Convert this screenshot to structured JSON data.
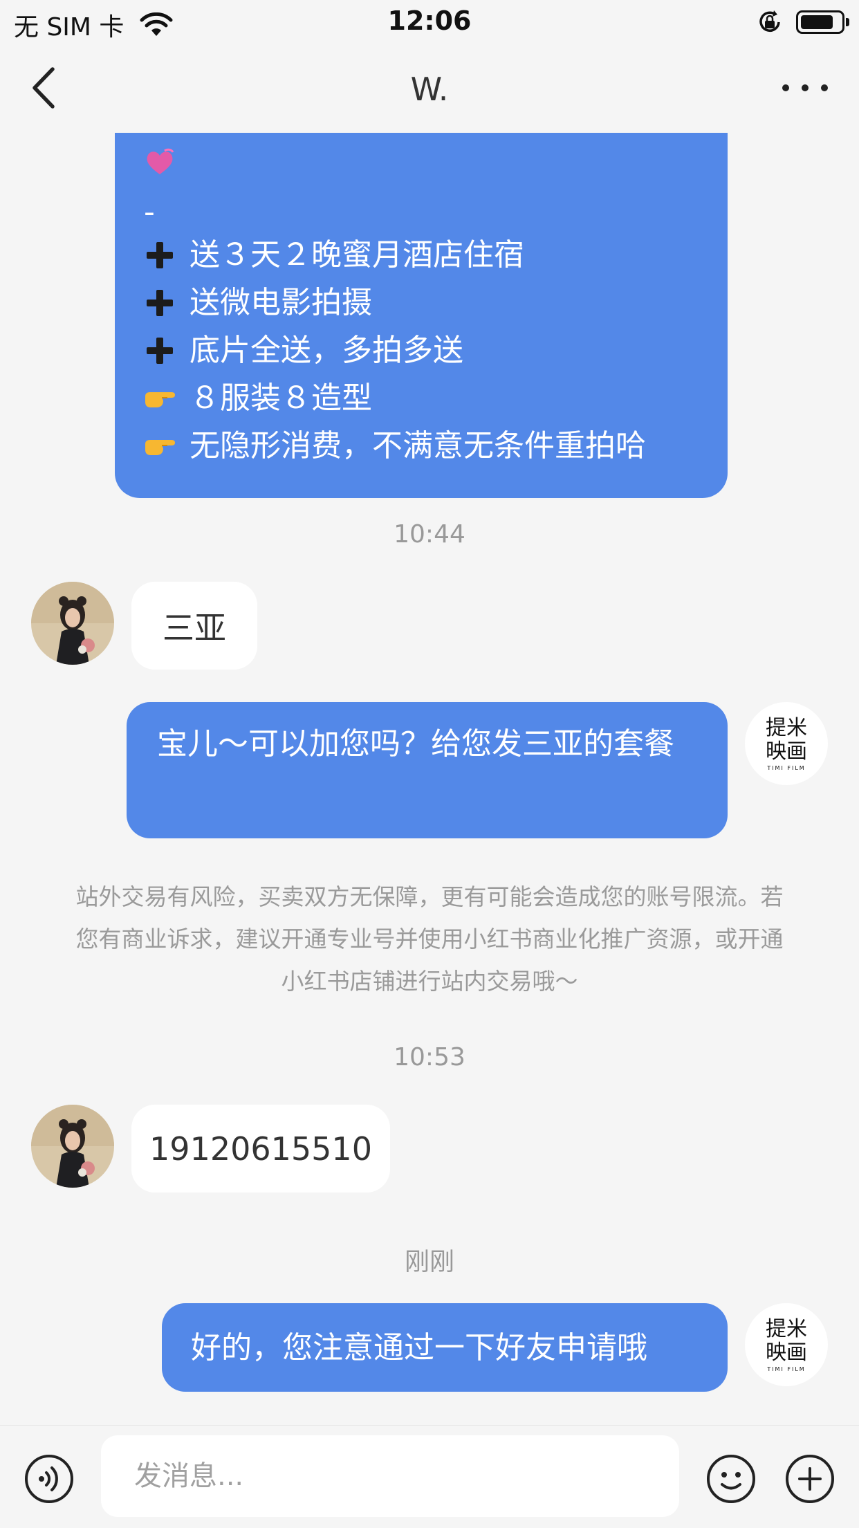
{
  "status_bar": {
    "carrier": "无 SIM 卡",
    "time": "12:06",
    "icons": [
      "wifi-icon",
      "rotation-lock-icon",
      "battery-icon"
    ]
  },
  "nav": {
    "title": "W.",
    "back_icon": "chevron-left-icon",
    "more_icon": "ellipsis-icon"
  },
  "messages": {
    "promo_lines": [
      {
        "icon": "heart-icon",
        "text": ""
      },
      {
        "icon": "",
        "text": "-"
      },
      {
        "icon": "plus-icon",
        "text": "送３天２晚蜜月酒店住宿"
      },
      {
        "icon": "plus-icon",
        "text": "送微电影拍摄"
      },
      {
        "icon": "plus-icon",
        "text": "底片全送，多拍多送"
      },
      {
        "icon": "pointing-hand-icon",
        "text": "８服装８造型"
      },
      {
        "icon": "pointing-hand-icon",
        "text": "无隐形消费，不满意无条件重拍哈"
      }
    ],
    "time_1": "10:44",
    "in_1": "三亚",
    "out_1": "宝儿～可以加您吗？给您发三亚的套餐",
    "notice": "站外交易有风险，买卖双方无保障，更有可能会造成您的账号限流。若您有商业诉求，建议开通专业号并使用小红书商业化推广资源，或开通小红书店铺进行站内交易哦～",
    "time_2": "10:53",
    "in_2": "19120615510",
    "time_3": "刚刚",
    "out_2": "好的，您注意通过一下好友申请哦"
  },
  "brand_avatar": {
    "line1": "提米",
    "line2": "映画",
    "sub": "TIMI FILM"
  },
  "input_bar": {
    "placeholder": "发消息...",
    "voice_icon": "voice-icon",
    "emoji_icon": "emoji-icon",
    "add_icon": "plus-circle-icon"
  },
  "colors": {
    "bubble_out": "#5388e8",
    "bubble_in": "#ffffff",
    "background": "#f5f5f5",
    "muted_text": "#999999"
  }
}
